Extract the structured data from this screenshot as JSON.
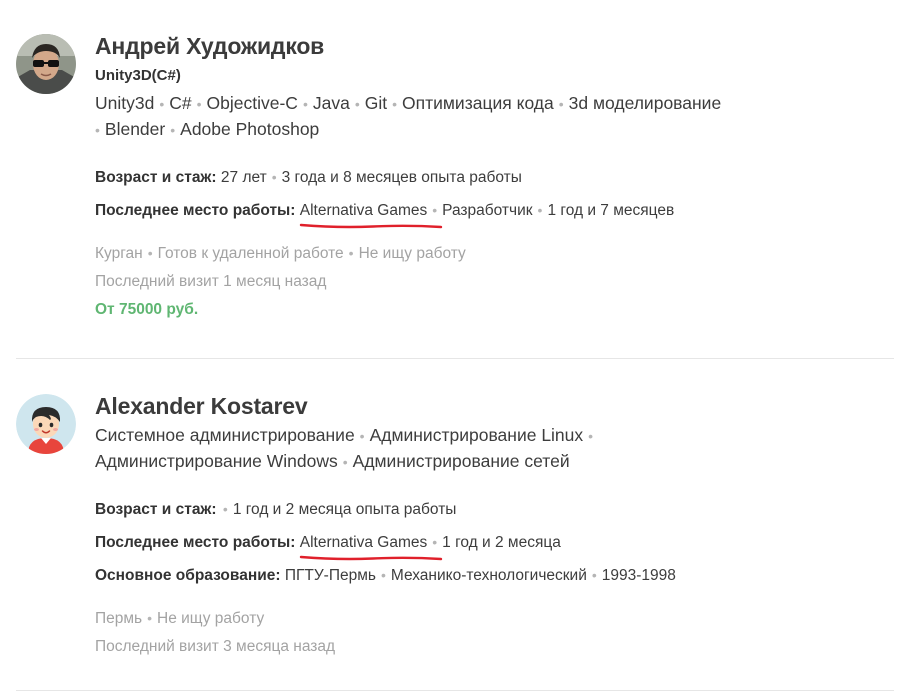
{
  "resumes": [
    {
      "name": "Андрей Художидков",
      "specialty": "Unity3D(C#)",
      "skills": [
        "Unity3d",
        "C#",
        "Objective-C",
        "Java",
        "Git",
        "Оптимизация кода",
        "3d моделирование",
        "Blender",
        "Adobe Photoshop"
      ],
      "age_label": "Возраст и стаж:",
      "age": "27 лет",
      "experience": "3 года и 8 месяцев опыта работы",
      "last_job_label": "Последнее место работы:",
      "company": "Alternativa Games",
      "position": "Разработчик",
      "job_duration": "1 год и 7 месяцев",
      "city": "Курган",
      "remote": "Готов к удаленной работе",
      "job_status": "Не ищу работу",
      "last_visit": "Последний визит 1 месяц назад",
      "salary": "От 75000 руб."
    },
    {
      "name": "Alexander Kostarev",
      "skills": [
        "Системное администрирование",
        "Администрирование Linux",
        "Администрирование Windows",
        "Администрирование сетей"
      ],
      "age_label": "Возраст и стаж:",
      "experience": "1 год и 2 месяца опыта работы",
      "last_job_label": "Последнее место работы:",
      "company": "Alternativa Games",
      "job_duration": "1 год и 2 месяца",
      "education_label": "Основное образование:",
      "education_school": "ПГТУ-Пермь",
      "education_faculty": "Механико-технологический",
      "education_years": "1993-1998",
      "city": "Пермь",
      "job_status": "Не ищу работу",
      "last_visit": "Последний визит 3 месяца назад"
    }
  ],
  "colors": {
    "salary": "#5fb672",
    "underline": "#e0202b",
    "muted": "#a3a3a3"
  },
  "icons": {
    "avatar1": "user-photo-avatar",
    "avatar2": "cartoon-person-avatar"
  }
}
